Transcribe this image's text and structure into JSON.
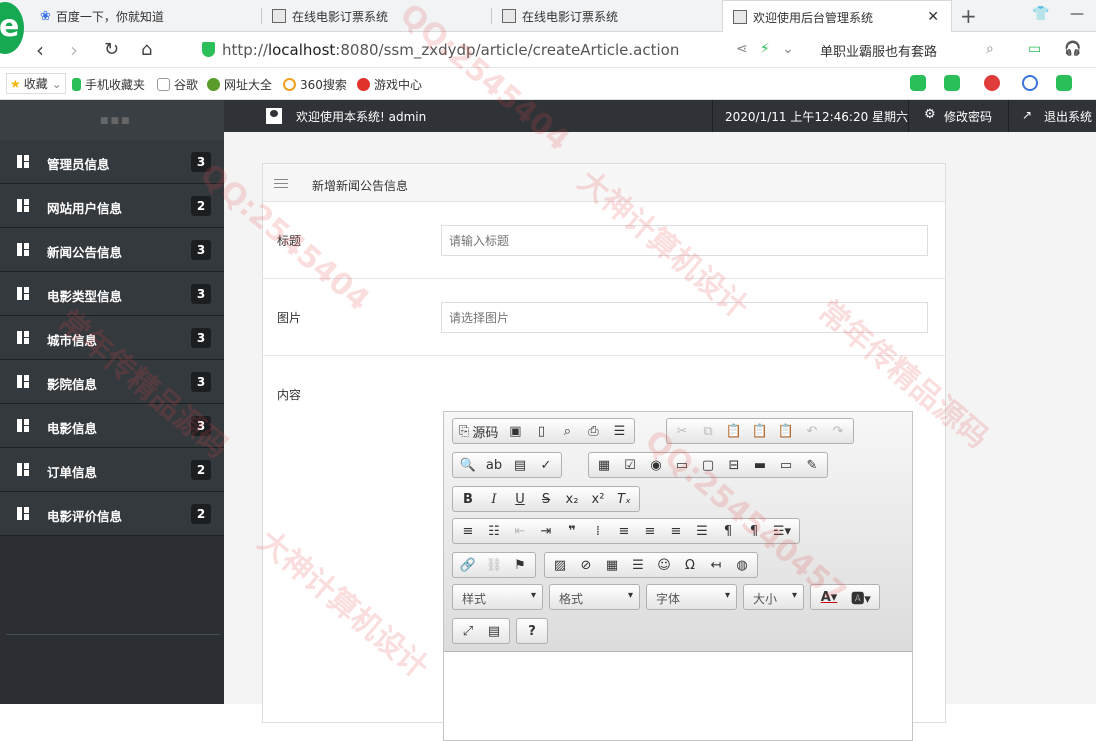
{
  "browser": {
    "tabs": [
      {
        "title": "百度一下，你就知道"
      },
      {
        "title": "在线电影订票系统"
      },
      {
        "title": "在线电影订票系统"
      },
      {
        "title": "欢迎使用后台管理系统"
      }
    ],
    "url_prefix": "http://",
    "url_host": "localhost",
    "url_rest": ":8080/ssm_zxdydp/article/createArticle.action",
    "search_text": "单职业霸服也有套路",
    "bookmarks": [
      {
        "label": "收藏"
      },
      {
        "label": "手机收藏夹"
      },
      {
        "label": "谷歌"
      },
      {
        "label": "网址大全"
      },
      {
        "label": "360搜索"
      },
      {
        "label": "游戏中心"
      }
    ]
  },
  "header": {
    "welcome": "欢迎使用本系统! admin",
    "datetime": "2020/1/11 上午12:46:20 星期六",
    "change_password": "修改密码",
    "logout": "退出系统"
  },
  "sidebar": {
    "items": [
      {
        "label": "管理员信息",
        "count": "3"
      },
      {
        "label": "网站用户信息",
        "count": "2"
      },
      {
        "label": "新闻公告信息",
        "count": "3"
      },
      {
        "label": "电影类型信息",
        "count": "3"
      },
      {
        "label": "城市信息",
        "count": "3"
      },
      {
        "label": "影院信息",
        "count": "3"
      },
      {
        "label": "电影信息",
        "count": "3"
      },
      {
        "label": "订单信息",
        "count": "2"
      },
      {
        "label": "电影评价信息",
        "count": "2"
      }
    ]
  },
  "form": {
    "panel_title": "新增新闻公告信息",
    "title_label": "标题",
    "title_placeholder": "请输入标题",
    "image_label": "图片",
    "image_placeholder": "请选择图片",
    "content_label": "内容",
    "editor": {
      "source_label": "源码",
      "style_combo": "样式",
      "format_combo": "格式",
      "font_combo": "字体",
      "size_combo": "大小"
    }
  },
  "watermarks": [
    "QQ:2545404",
    "大神计算机设计",
    "常年传精品源码",
    "QQ:2545404",
    "大神计算机设计",
    "常年传精品源码",
    "QQ:254540457"
  ]
}
